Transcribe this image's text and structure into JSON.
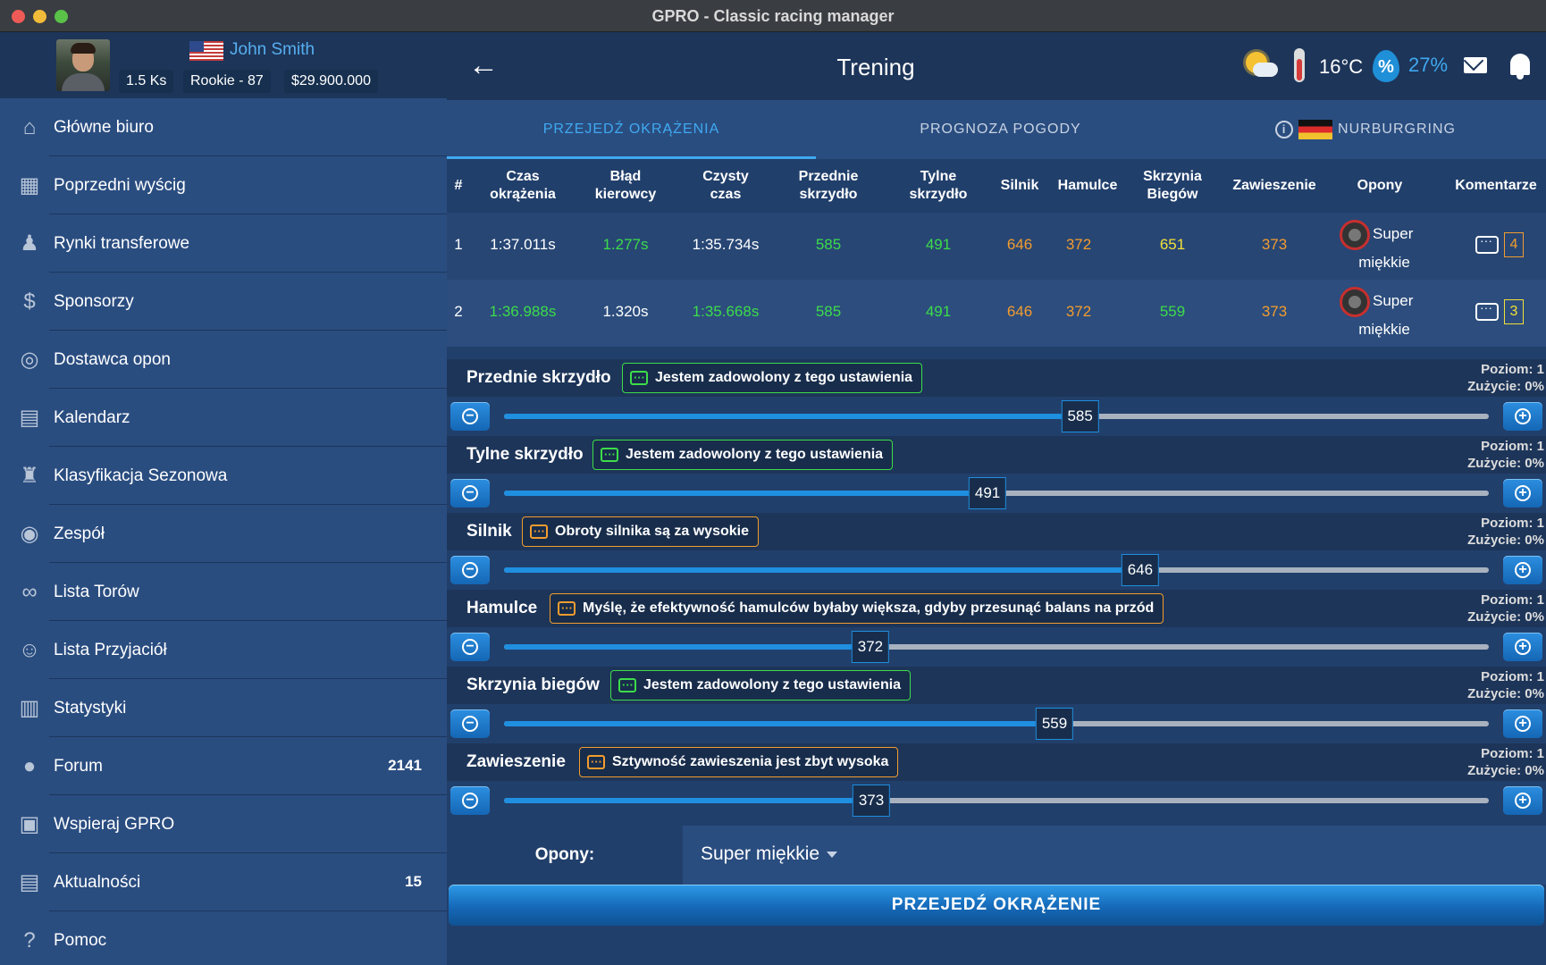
{
  "window": {
    "title": "GPRO - Classic racing manager"
  },
  "profile": {
    "name": "John Smith",
    "ks": "1.5 Ks",
    "rank": "Rookie - 87",
    "money": "$29.900.000"
  },
  "sidebar": {
    "items": [
      {
        "label": "Główne biuro",
        "icon": "home-icon",
        "count": ""
      },
      {
        "label": "Poprzedni wyścig",
        "icon": "calendar-icon",
        "count": ""
      },
      {
        "label": "Rynki transferowe",
        "icon": "person-icon",
        "count": ""
      },
      {
        "label": "Sponsorzy",
        "icon": "dollar-icon",
        "count": ""
      },
      {
        "label": "Dostawca opon",
        "icon": "tyre-icon",
        "count": ""
      },
      {
        "label": "Kalendarz",
        "icon": "calendar-grid-icon",
        "count": ""
      },
      {
        "label": "Klasyfikacja Sezonowa",
        "icon": "trophy-icon",
        "count": ""
      },
      {
        "label": "Zespół",
        "icon": "team-icon",
        "count": ""
      },
      {
        "label": "Lista Torów",
        "icon": "track-icon",
        "count": ""
      },
      {
        "label": "Lista Przyjaciół",
        "icon": "friends-icon",
        "count": ""
      },
      {
        "label": "Statystyki",
        "icon": "stats-icon",
        "count": ""
      },
      {
        "label": "Forum",
        "icon": "chat-icon",
        "count": "2141"
      },
      {
        "label": "Wspieraj GPRO",
        "icon": "money-icon",
        "count": ""
      },
      {
        "label": "Aktualności",
        "icon": "news-icon",
        "count": "15"
      },
      {
        "label": "Pomoc",
        "icon": "help-icon",
        "count": ""
      }
    ]
  },
  "header": {
    "title": "Trening",
    "temperature": "16°C",
    "humidity": "27%"
  },
  "tabs": {
    "laps": "PRZEJEDŹ OKRĄŻENIA",
    "forecast": "PROGNOZA POGODY",
    "track": "NURBURGRING"
  },
  "table": {
    "headers": {
      "num": "#",
      "laptime": [
        "Czas",
        "okrążenia"
      ],
      "error": [
        "Błąd",
        "kierowcy"
      ],
      "net": [
        "Czysty",
        "czas"
      ],
      "fwing": [
        "Przednie",
        "skrzydło"
      ],
      "rwing": [
        "Tylne",
        "skrzydło"
      ],
      "engine": "Silnik",
      "brakes": "Hamulce",
      "gear": [
        "Skrzynia",
        "Biegów"
      ],
      "susp": "Zawieszenie",
      "tyres": "Opony",
      "comments": "Komentarze"
    },
    "rows": [
      {
        "num": "1",
        "laptime": "1:37.011s",
        "error": "1.277s",
        "net": "1:35.734s",
        "fwing": "585",
        "rwing": "491",
        "engine": "646",
        "brakes": "372",
        "gear": "651",
        "susp": "373",
        "tyre1": "Super",
        "tyre2": "miękkie",
        "comments": "4"
      },
      {
        "num": "2",
        "laptime": "1:36.988s",
        "error": "1.320s",
        "net": "1:35.668s",
        "fwing": "585",
        "rwing": "491",
        "engine": "646",
        "brakes": "372",
        "gear": "559",
        "susp": "373",
        "tyre1": "Super",
        "tyre2": "miękkie",
        "comments": "3"
      }
    ]
  },
  "setup": [
    {
      "name": "Przednie skrzydło",
      "comment": "Jestem zadowolony z tego ustawienia",
      "tone": "green",
      "level": "Poziom: 1",
      "wear": "Zużycie: 0%",
      "value": "585",
      "fraction": 0.585
    },
    {
      "name": "Tylne skrzydło",
      "comment": "Jestem zadowolony z tego ustawienia",
      "tone": "green",
      "level": "Poziom: 1",
      "wear": "Zużycie: 0%",
      "value": "491",
      "fraction": 0.491
    },
    {
      "name": "Silnik",
      "comment": "Obroty silnika są za wysokie",
      "tone": "orange",
      "level": "Poziom: 1",
      "wear": "Zużycie: 0%",
      "value": "646",
      "fraction": 0.646
    },
    {
      "name": "Hamulce",
      "comment": "Myślę, że efektywność hamulców byłaby większa, gdyby przesunąć balans na przód",
      "tone": "orange",
      "level": "Poziom: 1",
      "wear": "Zużycie: 0%",
      "value": "372",
      "fraction": 0.372
    },
    {
      "name": "Skrzynia biegów",
      "comment": "Jestem zadowolony z tego ustawienia",
      "tone": "green",
      "level": "Poziom: 1",
      "wear": "Zużycie: 0%",
      "value": "559",
      "fraction": 0.559
    },
    {
      "name": "Zawieszenie",
      "comment": "Sztywność zawieszenia jest zbyt wysoka",
      "tone": "orange",
      "level": "Poziom: 1",
      "wear": "Zużycie: 0%",
      "value": "373",
      "fraction": 0.373
    }
  ],
  "tyres": {
    "label": "Opony:",
    "selected": "Super miękkie"
  },
  "action": {
    "label": "PRZEJEDŹ OKRĄŻENIE"
  }
}
